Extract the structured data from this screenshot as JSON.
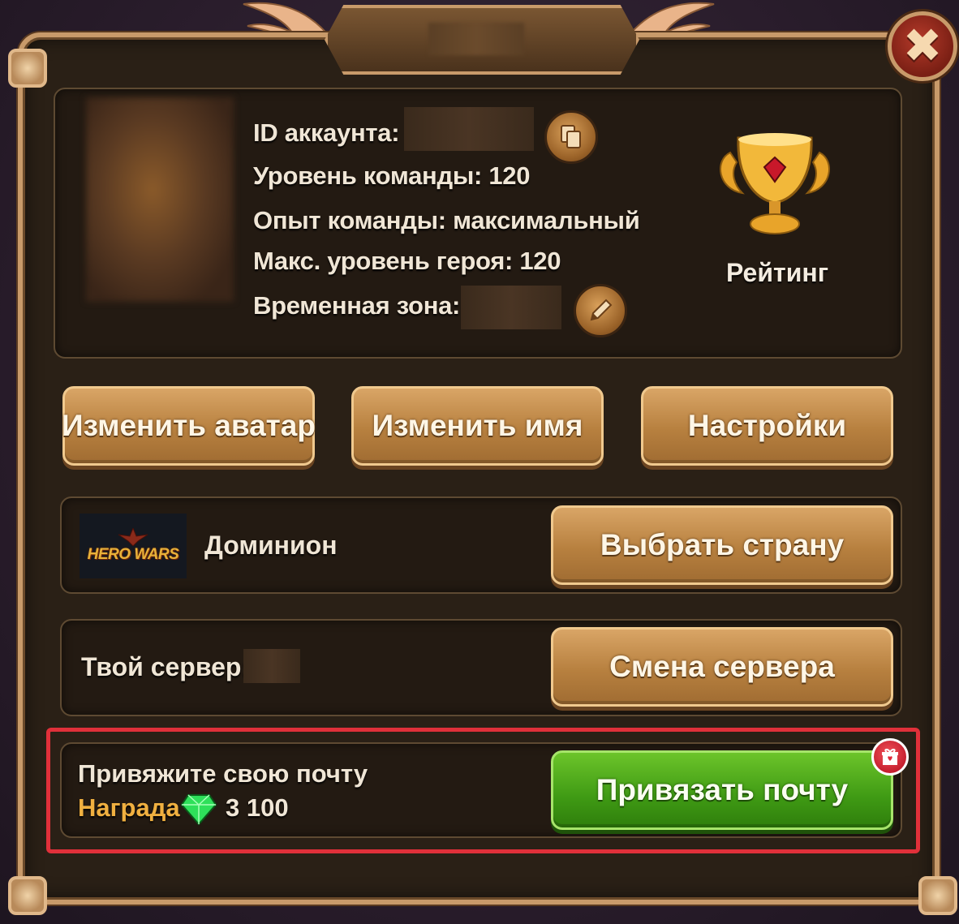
{
  "close_icon": "✖",
  "profile": {
    "account_id_label": "ID аккаунта:",
    "team_level_label": "Уровень команды: 120",
    "team_exp_label": "Опыт команды: максимальный",
    "max_hero_level_label": "Макс. уровень героя: 120",
    "timezone_label": "Временная зона:"
  },
  "rating": {
    "label": "Рейтинг"
  },
  "actions": {
    "change_avatar": "Изменить аватар",
    "change_name": "Изменить имя",
    "settings": "Настройки"
  },
  "country": {
    "logo_text": "HERO WARS",
    "name": "Доминион",
    "select_button": "Выбрать страну"
  },
  "server": {
    "label": "Твой сервер:",
    "change_button": "Смена сервера"
  },
  "email": {
    "prompt": "Привяжите свою почту",
    "reward_label": "Награда",
    "reward_amount": "3 100",
    "bind_button": "Привязать почту"
  },
  "colors": {
    "highlight_border": "#e0303a",
    "gold_button": "#b7803f",
    "green_button": "#3f9a14",
    "reward_text": "#f0b040"
  }
}
